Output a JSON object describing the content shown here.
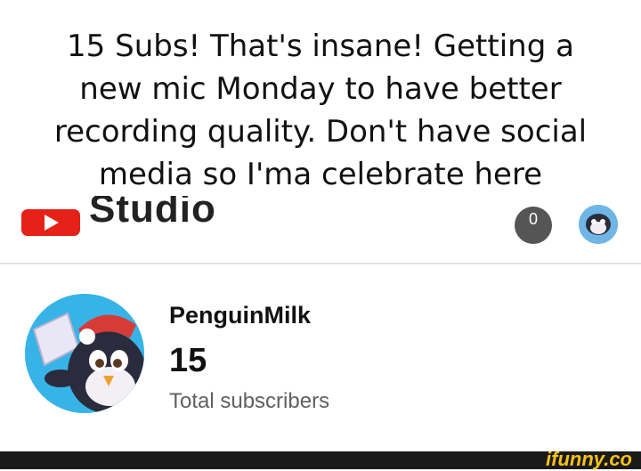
{
  "caption": {
    "line1": "15 Subs! That's insane! Getting a",
    "line2": "new mic Monday to have better",
    "line3": "recording quality. Don't have social",
    "line4": "media so I'ma celebrate here"
  },
  "header": {
    "logo_icon": "youtube-play-icon",
    "studio_label": "Studio",
    "notification_count": "0",
    "brand_color": "#e62117"
  },
  "channel": {
    "name": "PenguinMilk",
    "subscriber_count": "15",
    "subscriber_label": "Total subscribers"
  },
  "watermark": {
    "text": "ifunny.co",
    "color": "#f6c21b"
  }
}
